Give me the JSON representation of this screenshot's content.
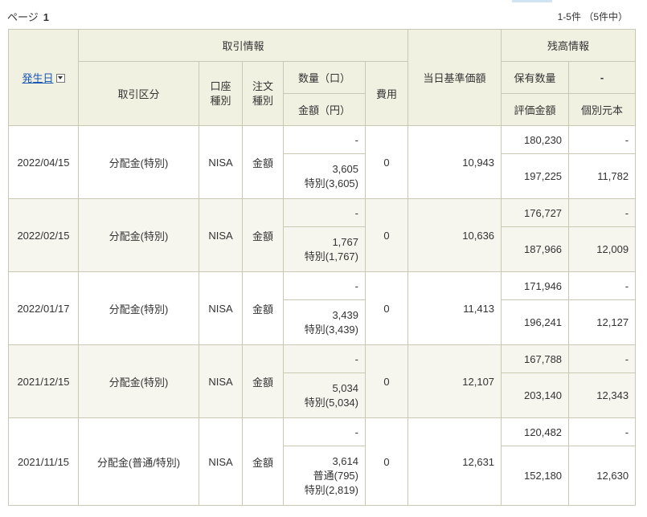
{
  "pager": {
    "label": "ページ",
    "current": "1",
    "count": "1-5件 （5件中）"
  },
  "header": {
    "date": "発生日",
    "trade_info": "取引情報",
    "trade_type": "取引区分",
    "account_type": "口座\n種別",
    "order_type": "注文\n種別",
    "quantity": "数量（口）",
    "amount": "金額（円）",
    "fee": "費用",
    "nav": "当日基準価額",
    "balance_info": "残高情報",
    "holding_qty": "保有数量",
    "dash": "-",
    "valuation": "評価金額",
    "individual_principal": "個別元本"
  },
  "rows": [
    {
      "date": "2022/04/15",
      "type": "分配金(特別)",
      "account": "NISA",
      "order": "金額",
      "qty": "-",
      "amount_lines": "3,605\n特別(3,605)",
      "fee": "0",
      "nav": "10,943",
      "holding": "180,230",
      "dash": "-",
      "valuation": "197,225",
      "principal": "11,782"
    },
    {
      "date": "2022/02/15",
      "type": "分配金(特別)",
      "account": "NISA",
      "order": "金額",
      "qty": "-",
      "amount_lines": "1,767\n特別(1,767)",
      "fee": "0",
      "nav": "10,636",
      "holding": "176,727",
      "dash": "-",
      "valuation": "187,966",
      "principal": "12,009"
    },
    {
      "date": "2022/01/17",
      "type": "分配金(特別)",
      "account": "NISA",
      "order": "金額",
      "qty": "-",
      "amount_lines": "3,439\n特別(3,439)",
      "fee": "0",
      "nav": "11,413",
      "holding": "171,946",
      "dash": "-",
      "valuation": "196,241",
      "principal": "12,127"
    },
    {
      "date": "2021/12/15",
      "type": "分配金(特別)",
      "account": "NISA",
      "order": "金額",
      "qty": "-",
      "amount_lines": "5,034\n特別(5,034)",
      "fee": "0",
      "nav": "12,107",
      "holding": "167,788",
      "dash": "-",
      "valuation": "203,140",
      "principal": "12,343"
    },
    {
      "date": "2021/11/15",
      "type": "分配金(普通/特別)",
      "account": "NISA",
      "order": "金額",
      "qty": "-",
      "amount_lines": "3,614\n普通(795)\n特別(2,819)",
      "fee": "0",
      "nav": "12,631",
      "holding": "120,482",
      "dash": "-",
      "valuation": "152,180",
      "principal": "12,630"
    }
  ]
}
